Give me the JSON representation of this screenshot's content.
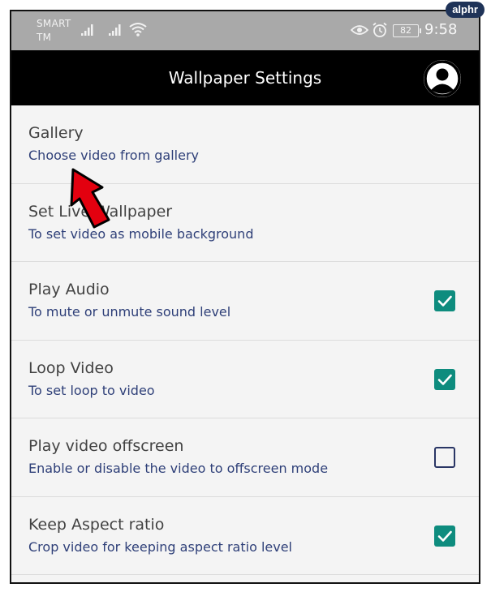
{
  "watermark": "alphr",
  "status_bar": {
    "carrier_line1": "SMART",
    "carrier_line2": "TM",
    "battery": "82",
    "time": "9:58"
  },
  "app_bar": {
    "title": "Wallpaper Settings"
  },
  "settings": [
    {
      "title": "Gallery",
      "subtitle": "Choose video from gallery"
    },
    {
      "title": "Set Live Wallpaper",
      "subtitle": "To set video as mobile background"
    },
    {
      "title": "Play Audio",
      "subtitle": "To mute or unmute sound level",
      "checked": true
    },
    {
      "title": "Loop Video",
      "subtitle": "To set loop to video",
      "checked": true
    },
    {
      "title": "Play video offscreen",
      "subtitle": "Enable or disable the video to offscreen mode",
      "checked": false
    },
    {
      "title": "Keep Aspect ratio",
      "subtitle": "Crop video for keeping aspect ratio level",
      "checked": true
    }
  ],
  "colors": {
    "status_bar": "#a9a9a9",
    "app_bar": "#000000",
    "checkbox_checked": "#0e8c7e",
    "checkbox_border": "#2a3665",
    "subtitle_text": "#2e3f78",
    "pointer_arrow": "#e3000f"
  },
  "icons": [
    "signal-icon",
    "wifi-icon",
    "eye-icon",
    "alarm-icon",
    "battery-icon",
    "account-avatar-icon",
    "checkbox-checked-icon",
    "checkbox-empty-icon",
    "red-pointer-arrow"
  ]
}
